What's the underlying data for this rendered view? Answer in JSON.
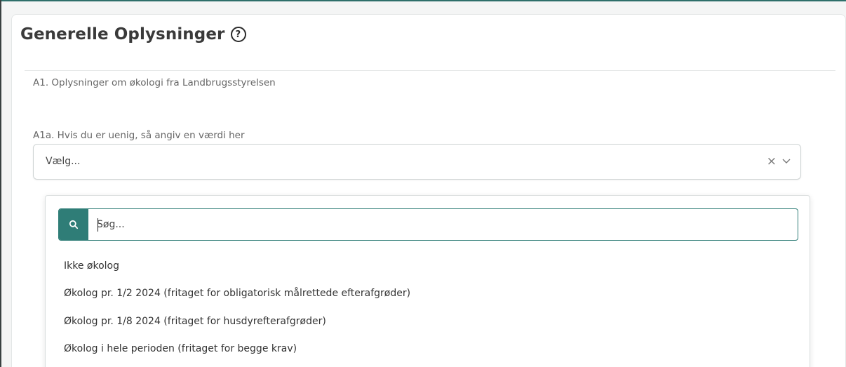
{
  "card": {
    "title": "Generelle Oplysninger",
    "help_icon_glyph": "?"
  },
  "section": {
    "label": "A1. Oplysninger om økologi fra Landbrugsstyrelsen"
  },
  "field": {
    "label": "A1a. Hvis du er uenig, så angiv en værdi her",
    "selected_value": "Vælg...",
    "clear_glyph": "×"
  },
  "dropdown": {
    "search_placeholder": "Søg...",
    "search_value": "",
    "options": [
      "Ikke økolog",
      "Økolog pr. 1/2 2024 (fritaget for obligatorisk målrettede efterafgrøder)",
      "Økolog pr. 1/8 2024 (fritaget for husdyrefterafgrøder)",
      "Økolog i hele perioden (fritaget for begge krav)"
    ]
  },
  "colors": {
    "accent": "#2f7d77",
    "frame_top": "#2e6f6a"
  }
}
